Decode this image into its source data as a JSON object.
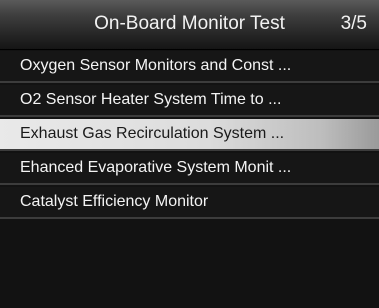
{
  "header": {
    "title": "On-Board Monitor Test",
    "page": "3/5"
  },
  "menu": {
    "items": [
      {
        "label": "Oxygen Sensor Monitors and Const ..."
      },
      {
        "label": "O2 Sensor Heater System Time to ..."
      },
      {
        "label": "Exhaust Gas Recirculation System ..."
      },
      {
        "label": "Ehanced Evaporative System Monit ..."
      },
      {
        "label": "Catalyst Efficiency Monitor"
      }
    ],
    "selected_index": 2
  },
  "colors": {
    "background": "#121212",
    "header": "#3a3a3a",
    "text": "#f4f4f4",
    "selected_bg": "#dcdcdc",
    "selected_text": "#1a1a1a",
    "divider": "#3c3c3c"
  }
}
